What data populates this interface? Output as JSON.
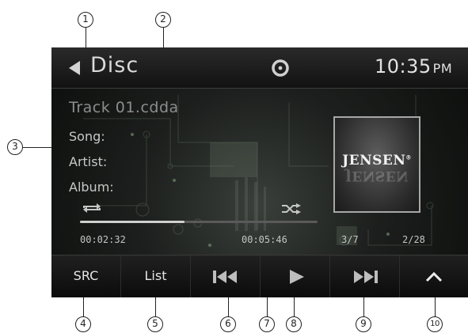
{
  "header": {
    "source_title": "Disc",
    "clock_time": "10:35",
    "clock_ampm": "PM"
  },
  "track": {
    "name": "Track 01.cdda",
    "song_label": "Song:",
    "artist_label": "Artist:",
    "album_label": "Album:"
  },
  "album_art": {
    "logo_text": "JENSEN",
    "logo_mark": "®"
  },
  "playback": {
    "elapsed": "00:02:32",
    "total": "00:05:46",
    "progress_fraction": 0.44,
    "track_position": "3/7",
    "folder_position": "2/28"
  },
  "controls": {
    "src_label": "SRC",
    "list_label": "List"
  },
  "icons": {
    "back": "back-arrow-icon",
    "disc": "disc-icon",
    "repeat": "repeat-icon",
    "shuffle": "shuffle-icon",
    "previous": "skip-previous-icon",
    "play": "play-icon",
    "next": "skip-next-icon",
    "up": "chevron-up-icon"
  },
  "colors": {
    "screen_background": "#1c1f1d",
    "text_primary": "#e2e2e2",
    "text_dim": "#8d8d8d",
    "accent_green": "#8fb08a"
  },
  "callouts": [
    "1",
    "2",
    "3",
    "4",
    "5",
    "6",
    "7",
    "8",
    "9",
    "10"
  ]
}
